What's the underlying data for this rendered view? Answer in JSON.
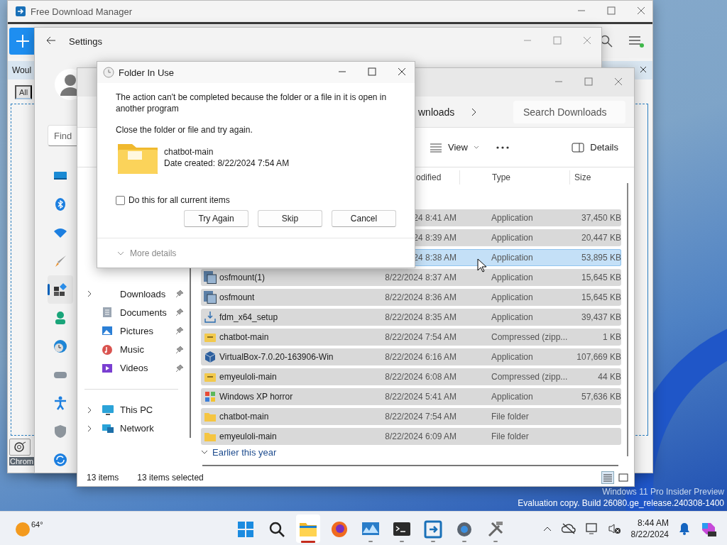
{
  "fdm": {
    "title": "Free Download Manager",
    "banner": "Woul",
    "tab": "All",
    "footer": "Chrom"
  },
  "settings": {
    "title": "Settings",
    "search": {
      "placeholder": "Find"
    },
    "nav": [
      {
        "kind": "display",
        "selected": false
      },
      {
        "kind": "bluetooth",
        "selected": false
      },
      {
        "kind": "network",
        "selected": false
      },
      {
        "kind": "personalization",
        "selected": false
      },
      {
        "kind": "apps",
        "selected": true
      },
      {
        "kind": "accounts",
        "selected": false
      },
      {
        "kind": "time",
        "selected": false
      },
      {
        "kind": "gaming",
        "selected": false
      },
      {
        "kind": "accessibility",
        "selected": false
      },
      {
        "kind": "privacy",
        "selected": false
      },
      {
        "kind": "update",
        "selected": false
      }
    ]
  },
  "explorer": {
    "address": "wnloads",
    "search": {
      "placeholder": "Search Downloads"
    },
    "view_label": "View",
    "details_label": "Details",
    "columns": [
      "odified",
      "Type",
      "Size"
    ],
    "nav": [
      {
        "label": "Downloads",
        "expandable": true,
        "pinned": true
      },
      {
        "label": "Documents",
        "kind": "documents",
        "expandable": false,
        "pinned": true
      },
      {
        "label": "Pictures",
        "kind": "pictures",
        "expandable": false,
        "pinned": true
      },
      {
        "label": "Music",
        "kind": "music",
        "expandable": false,
        "pinned": true
      },
      {
        "label": "Videos",
        "kind": "videos",
        "expandable": false,
        "pinned": true
      },
      {
        "label": "This PC",
        "kind": "pc",
        "expandable": true,
        "pinned": false
      },
      {
        "label": "Network",
        "kind": "network",
        "expandable": true,
        "pinned": false
      }
    ],
    "rows": [
      {
        "date": "24 8:41 AM",
        "type": "Application",
        "size": "37,450 KB",
        "selected": true,
        "hovered": false
      },
      {
        "date": "24 8:39 AM",
        "type": "Application",
        "size": "20,447 KB",
        "selected": true,
        "hovered": false
      },
      {
        "date": "24 8:38 AM",
        "type": "Application",
        "size": "53,895 KB",
        "selected": true,
        "hovered": true
      },
      {
        "kind": "disk",
        "name": "osfmount(1)",
        "date": "8/22/2024 8:37 AM",
        "type": "Application",
        "size": "15,645 KB",
        "selected": true,
        "hovered": false
      },
      {
        "kind": "disk",
        "name": "osfmount",
        "date": "8/22/2024 8:36 AM",
        "type": "Application",
        "size": "15,645 KB",
        "selected": true,
        "hovered": false
      },
      {
        "kind": "installer",
        "name": "fdm_x64_setup",
        "date": "8/22/2024 8:35 AM",
        "type": "Application",
        "size": "39,437 KB",
        "selected": true,
        "hovered": false
      },
      {
        "kind": "zip",
        "name": "chatbot-main",
        "date": "8/22/2024 7:54 AM",
        "type": "Compressed (zipp...",
        "size": "1 KB",
        "selected": true,
        "hovered": false
      },
      {
        "kind": "cube",
        "name": "VirtualBox-7.0.20-163906-Win",
        "date": "8/22/2024 6:16 AM",
        "type": "Application",
        "size": "107,669 KB",
        "selected": true,
        "hovered": false
      },
      {
        "kind": "zip",
        "name": "emyeuloli-main",
        "date": "8/22/2024 6:08 AM",
        "type": "Compressed (zipp...",
        "size": "44 KB",
        "selected": true,
        "hovered": false
      },
      {
        "kind": "flag",
        "name": "Windows XP horror",
        "date": "8/22/2024 5:41 AM",
        "type": "Application",
        "size": "57,636 KB",
        "selected": true,
        "hovered": false
      },
      {
        "kind": "folder",
        "name": "chatbot-main",
        "date": "8/22/2024 7:54 AM",
        "type": "File folder",
        "selected": true,
        "hovered": false
      },
      {
        "kind": "folder",
        "name": "emyeuloli-main",
        "date": "8/22/2024 6:09 AM",
        "type": "File folder",
        "selected": true,
        "hovered": false
      }
    ],
    "group": "Earlier this year",
    "status": {
      "count": "13 items",
      "selection": "13 items selected"
    },
    "layout_buttons": [
      {
        "kind": "details",
        "selected": true
      },
      {
        "kind": "tiles",
        "selected": false
      }
    ]
  },
  "dialog": {
    "title": "Folder In Use",
    "message": "The action can't be completed because the folder or a file in it is open in another program",
    "hint": "Close the folder or file and try again.",
    "item_name": "chatbot-main",
    "item_date": "Date created: 8/22/2024 7:54 AM",
    "checkbox": {
      "label": "Do this for all current items",
      "checked": false
    },
    "buttons": [
      "Try Again",
      "Skip",
      "Cancel"
    ],
    "more": "More details"
  },
  "watermark": [
    "Windows 11 Pro Insider Preview",
    "Evaluation copy. Build 26080.ge_release.240308-1400"
  ],
  "taskbar": {
    "weather": "64°",
    "apps": [
      {
        "kind": "start",
        "running": false,
        "active": false
      },
      {
        "kind": "search",
        "running": false,
        "active": false
      },
      {
        "kind": "explorer",
        "running": true,
        "active": true
      },
      {
        "kind": "firefox",
        "running": false,
        "active": false
      },
      {
        "kind": "monitor",
        "running": true,
        "active": false
      },
      {
        "kind": "terminal",
        "running": true,
        "active": false
      },
      {
        "kind": "fdm",
        "running": true,
        "active": false
      },
      {
        "kind": "settings",
        "running": true,
        "active": false
      },
      {
        "kind": "tools",
        "running": true,
        "active": false
      }
    ],
    "time": "8:44 AM",
    "date": "8/22/2024"
  }
}
